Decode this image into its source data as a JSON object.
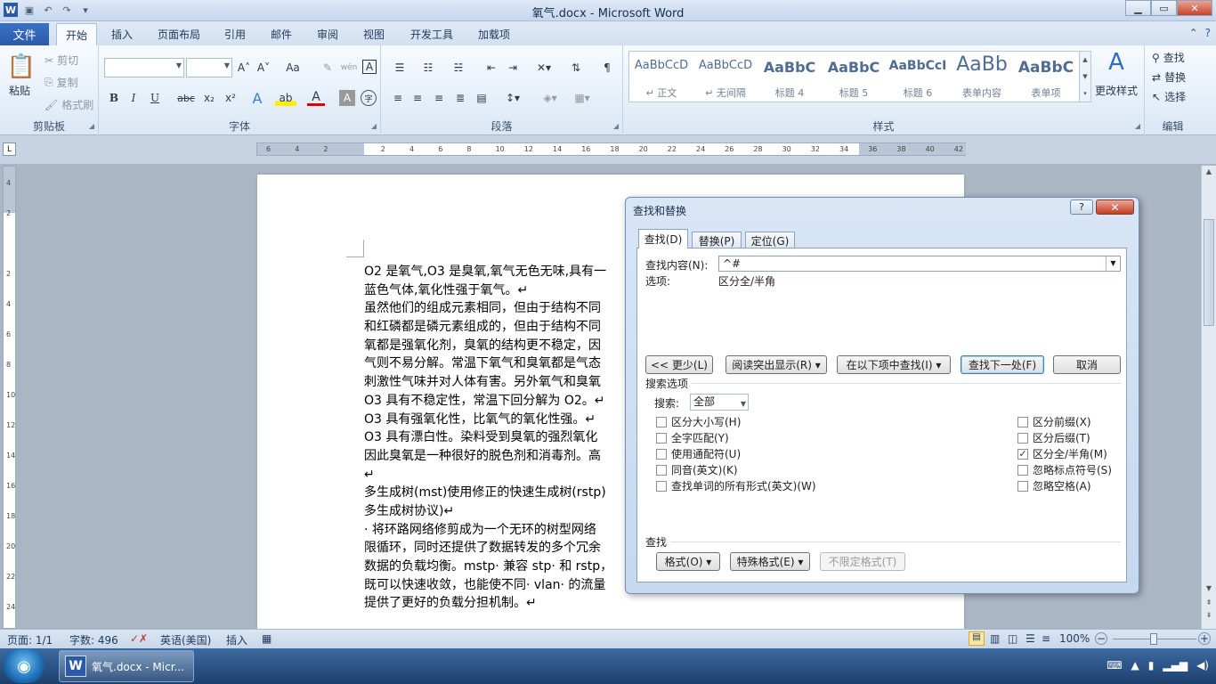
{
  "window": {
    "title": "氧气.docx - Microsoft Word",
    "minimize": "▁",
    "maximize": "▭",
    "close": "✕"
  },
  "qat": {
    "word_icon": "W",
    "save": "▣",
    "undo": "↶",
    "redo": "↷",
    "customize": "▾"
  },
  "tabs": {
    "file": "文件",
    "home": "开始",
    "insert": "插入",
    "layout": "页面布局",
    "references": "引用",
    "mailings": "邮件",
    "review": "审阅",
    "view": "视图",
    "developer": "开发工具",
    "addins": "加载项"
  },
  "ribbon": {
    "clipboard": {
      "label": "剪贴板",
      "paste": "粘贴",
      "cut": "剪切",
      "copy": "复制",
      "format_painter": "格式刷"
    },
    "font": {
      "label": "字体",
      "grow": "A˄",
      "shrink": "A˅",
      "case": "Aa",
      "clear": "✎",
      "phonetic": "wén",
      "border": "A",
      "bold": "B",
      "italic": "I",
      "underline": "U",
      "strike": "abc",
      "sub": "x₂",
      "sup": "x²",
      "effects": "A",
      "highlight": "ab",
      "color": "A",
      "shade": "A",
      "enclose": "字"
    },
    "paragraph": {
      "label": "段落"
    },
    "styles": {
      "label": "样式",
      "items": [
        {
          "preview": "AaBbCcD",
          "name": "↵ 正文"
        },
        {
          "preview": "AaBbCcD",
          "name": "↵ 无间隔"
        },
        {
          "preview": "AaBbC",
          "name": "标题 4"
        },
        {
          "preview": "AaBbC",
          "name": "标题 5"
        },
        {
          "preview": "AaBbCcI",
          "name": "标题 6"
        },
        {
          "preview": "AaBb",
          "name": "表单内容"
        },
        {
          "preview": "AaBbC",
          "name": "表单项"
        }
      ],
      "change": "更改样式"
    },
    "editing": {
      "label": "编辑",
      "find": "查找",
      "replace": "替换",
      "select": "选择"
    }
  },
  "ruler": {
    "ticks": [
      "6",
      "4",
      "2",
      "",
      "2",
      "4",
      "6",
      "8",
      "10",
      "12",
      "14",
      "16",
      "18",
      "20",
      "22",
      "24",
      "26",
      "28",
      "30",
      "32",
      "34",
      "36",
      "38",
      "40",
      "42"
    ],
    "vticks": [
      "4",
      "2",
      "",
      "2",
      "4",
      "6",
      "8",
      "10",
      "12",
      "14",
      "16",
      "18",
      "20",
      "22",
      "24"
    ]
  },
  "document": {
    "lines": [
      "O2 是氧气,O3 是臭氧,氧气无色无味,具有一",
      "蓝色气体,氧化性强于氧气。↵",
      "虽然他们的组成元素相同，但由于结构不同",
      "和红磷都是磷元素组成的，但由于结构不同",
      "氧都是强氧化剂，臭氧的结构更不稳定，因",
      "气则不易分解。常温下氧气和臭氧都是气态",
      "刺激性气味并对人体有害。另外氧气和臭氧",
      "O3 具有不稳定性，常温下回分解为 O2。↵",
      "O3 具有强氧化性，比氧气的氧化性强。↵",
      "O3 具有漂白性。染料受到臭氧的强烈氧化",
      "因此臭氧是一种很好的脱色剂和消毒剂。高",
      "↵",
      "多生成树(mst)使用修正的快速生成树(rstp)",
      "多生成树协议)↵",
      "· 将环路网络修剪成为一个无环的树型网络",
      "限循环，同时还提供了数据转发的多个冗余",
      "数据的负载均衡。mstp· 兼容 stp· 和 rstp，",
      "既可以快速收敛，也能使不同· vlan· 的流量",
      "提供了更好的负载分担机制。↵"
    ]
  },
  "dialog": {
    "title": "查找和替换",
    "help": "?",
    "close": "✕",
    "tabs": {
      "find": "查找(D)",
      "replace": "替换(P)",
      "goto": "定位(G)"
    },
    "find_label": "查找内容(N):",
    "find_value": "^#",
    "options_label": "选项:",
    "options_value": "区分全/半角",
    "buttons": {
      "less": "<< 更少(L)",
      "highlight": "阅读突出显示(R) ▾",
      "findin": "在以下项中查找(I) ▾",
      "findnext": "查找下一处(F)",
      "cancel": "取消"
    },
    "search_options": "搜索选项",
    "search_label": "搜索:",
    "search_value": "全部",
    "checks_left": [
      {
        "label": "区分大小写(H)",
        "checked": false
      },
      {
        "label": "全字匹配(Y)",
        "checked": false
      },
      {
        "label": "使用通配符(U)",
        "checked": false
      },
      {
        "label": "同音(英文)(K)",
        "checked": false
      },
      {
        "label": "查找单词的所有形式(英文)(W)",
        "checked": false
      }
    ],
    "checks_right": [
      {
        "label": "区分前缀(X)",
        "checked": false
      },
      {
        "label": "区分后缀(T)",
        "checked": false
      },
      {
        "label": "区分全/半角(M)",
        "checked": true
      },
      {
        "label": "忽略标点符号(S)",
        "checked": false
      },
      {
        "label": "忽略空格(A)",
        "checked": false
      }
    ],
    "find_section": "查找",
    "format_btn": "格式(O) ▾",
    "special_btn": "特殊格式(E) ▾",
    "noformat_btn": "不限定格式(T)"
  },
  "status": {
    "page": "页面: 1/1",
    "words": "字数: 496",
    "lang": "英语(美国)",
    "mode": "插入",
    "zoom": "100%",
    "zoom_out": "−",
    "zoom_in": "+"
  },
  "taskbar": {
    "task_label": "氧气.docx - Micr...",
    "start": "◉"
  }
}
